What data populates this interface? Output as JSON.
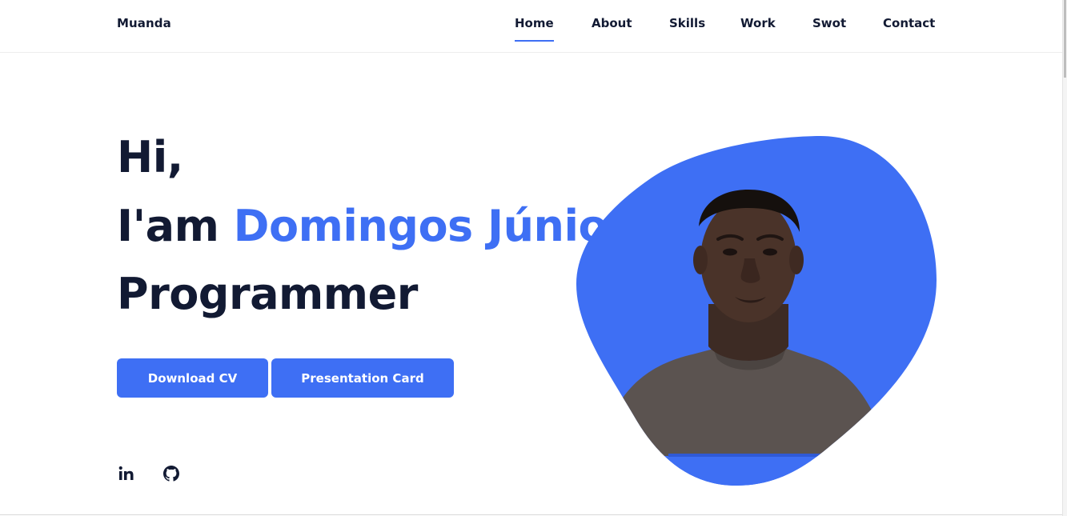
{
  "header": {
    "logo": "Muanda",
    "nav": [
      {
        "label": "Home",
        "active": true
      },
      {
        "label": "About",
        "active": false
      },
      {
        "label": "Skills",
        "active": false
      },
      {
        "label": "Work",
        "active": false
      },
      {
        "label": "Swot",
        "active": false
      },
      {
        "label": "Contact",
        "active": false
      }
    ]
  },
  "hero": {
    "greeting": "Hi,",
    "intro_prefix": "I'am ",
    "name": "Domingos Júnior",
    "role": "Programmer",
    "buttons": {
      "download_cv": "Download CV",
      "presentation_card": "Presentation Card"
    },
    "social": [
      {
        "icon": "linkedin-icon"
      },
      {
        "icon": "github-icon"
      }
    ],
    "photo_subject": "profile-photo"
  },
  "colors": {
    "accent": "#3e6ff4",
    "text": "#121a33",
    "background": "#ffffff"
  }
}
